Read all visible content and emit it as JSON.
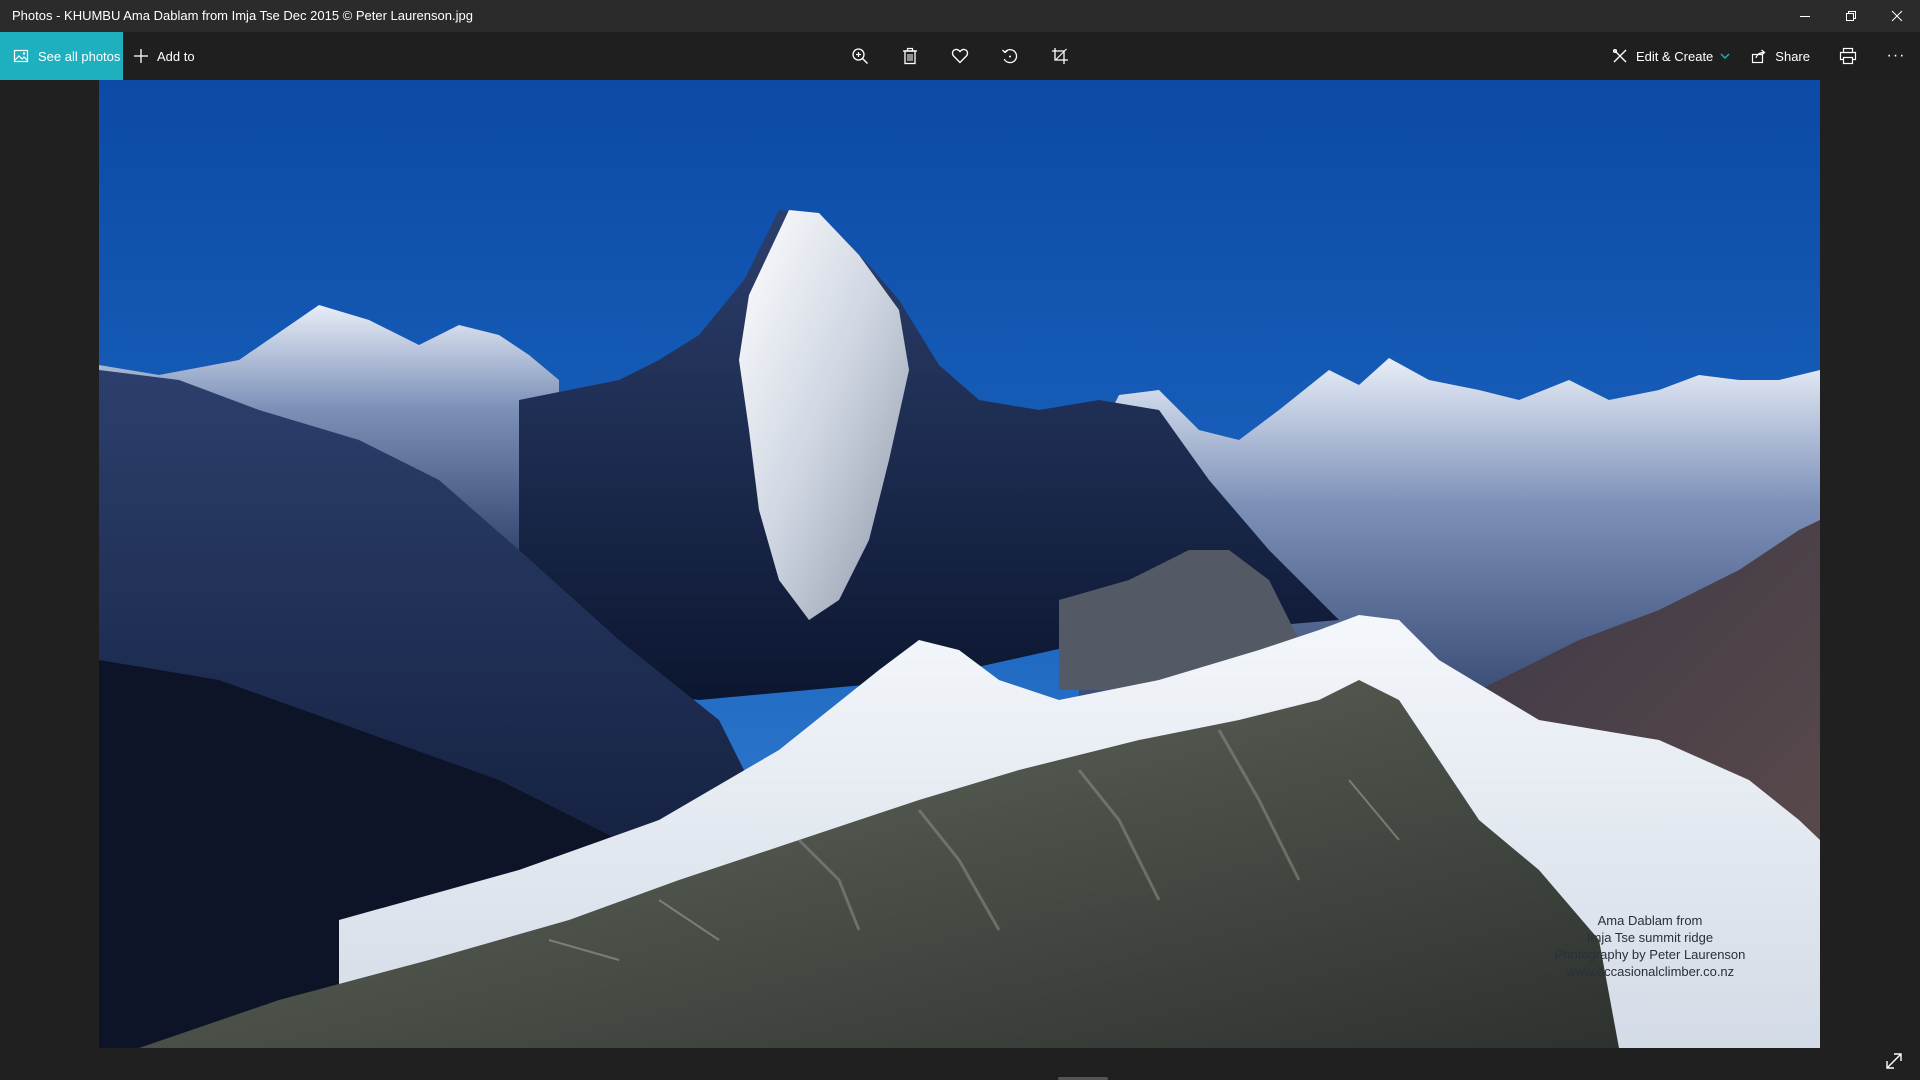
{
  "window": {
    "title": "Photos - KHUMBU Ama Dablam from Imja Tse Dec 2015 © Peter Laurenson.jpg",
    "controls": [
      "minimize-icon",
      "restore-icon",
      "close-icon"
    ]
  },
  "toolbar": {
    "see_all_label": "See all photos",
    "add_to_label": "Add to",
    "center_tools": [
      "zoom-in-icon",
      "delete-icon",
      "heart-icon",
      "rotate-icon",
      "crop-icon"
    ],
    "edit_create_label": "Edit & Create",
    "share_label": "Share",
    "more_label": "···"
  },
  "photo": {
    "caption": [
      "Ama Dablam from",
      "Imja Tse summit ridge",
      "Photography by Peter Laurenson",
      "www.occasionalclimber.co.nz"
    ]
  },
  "colors": {
    "accent": "#1fb0c0",
    "titlebar": "#2b2b2b",
    "toolbar": "#1f1f1f",
    "background": "#202020"
  }
}
